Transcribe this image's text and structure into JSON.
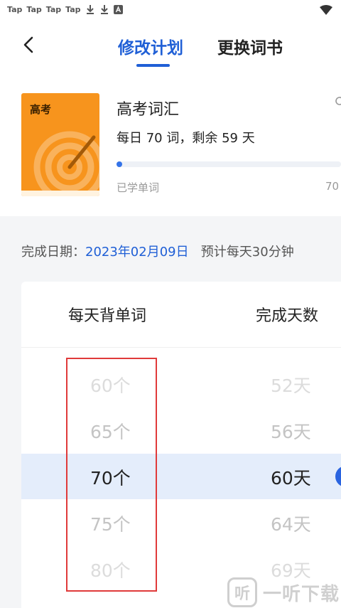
{
  "status_bar": {
    "apps": [
      "Tap",
      "Tap",
      "Tap",
      "Tap"
    ]
  },
  "header": {
    "tab_plan": "修改计划",
    "tab_book": "更换词书"
  },
  "book": {
    "cover_title": "高考",
    "name": "高考词汇",
    "plan_text": "每日 70 词，剩余 59 天",
    "progress_fraction": 0.02,
    "learned_label": "已学单词",
    "learned_total": "70"
  },
  "plan": {
    "finish_label": "完成日期：",
    "finish_date": "2023年02月09日",
    "estimate": "预计每天30分钟"
  },
  "picker": {
    "col_words": "每天背单词",
    "col_days": "完成天数",
    "words": [
      "60个",
      "65个",
      "70个",
      "75个",
      "80个"
    ],
    "days": [
      "52天",
      "56天",
      "60天",
      "64天",
      "69天"
    ],
    "selected_index": 2
  },
  "watermark": {
    "icon_text": "听",
    "text": "一听下载"
  },
  "colors": {
    "accent": "#1f5fd6",
    "cover": "#f7941d",
    "selected_band": "#e4edfb",
    "annotation": "#e03a3a"
  }
}
